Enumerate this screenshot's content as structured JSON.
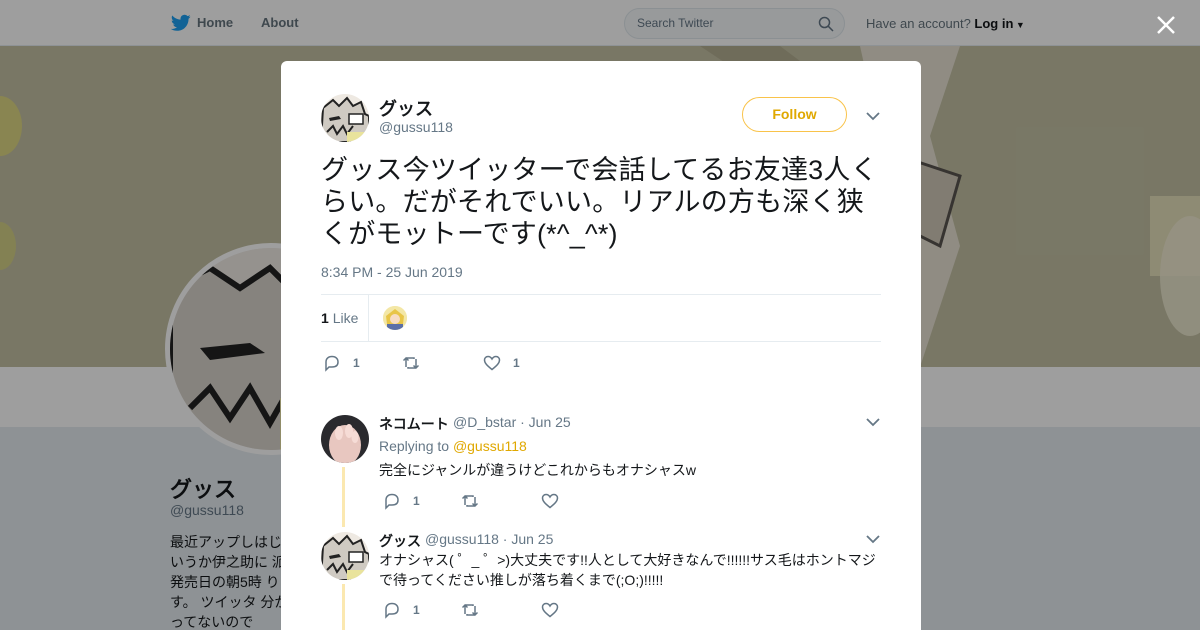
{
  "topbar": {
    "home_label": "Home",
    "about_label": "About",
    "search_placeholder": "Search Twitter",
    "account_prompt": "Have an account?",
    "login_label": "Log in"
  },
  "profile": {
    "name": "グッス",
    "handle": "@gussu118",
    "bio": "最近アップしはじ というか伊之助に 派。発売日の朝5時 ります。 ツイッタ 分かってないので"
  },
  "tweet": {
    "author_name": "グッス",
    "author_handle": "@gussu118",
    "follow_label": "Follow",
    "text": "グッス今ツイッターで会話してるお友達3人くらい。だがそれでいい。リアルの方も深く狭くがモットーです(*^_^*)",
    "timestamp": "8:34 PM - 25 Jun 2019",
    "like_count": "1",
    "like_label": "Like",
    "reply_count": "1",
    "favorite_count": "1"
  },
  "replies": [
    {
      "name": "ネコムート",
      "handle": "@D_bstar",
      "date": "· Jun 25",
      "replying_prefix": "Replying to",
      "replying_handle": "@gussu118",
      "text": "完全にジャンルが違うけどこれからもオナシャスw",
      "reply_count": "1"
    },
    {
      "name": "グッス",
      "handle": "@gussu118",
      "date": "· Jun 25",
      "text": "オナシャス( ゜_ ゜>)大丈夫です!!人として大好きなんで!!!!!!サス毛はホントマジで待ってください推しが落ち着くまで(;O;)!!!!!",
      "reply_count": "1"
    }
  ],
  "colors": {
    "accent": "#f9c34a",
    "twitter_blue": "#1da1f2",
    "text_secondary": "#657786"
  }
}
